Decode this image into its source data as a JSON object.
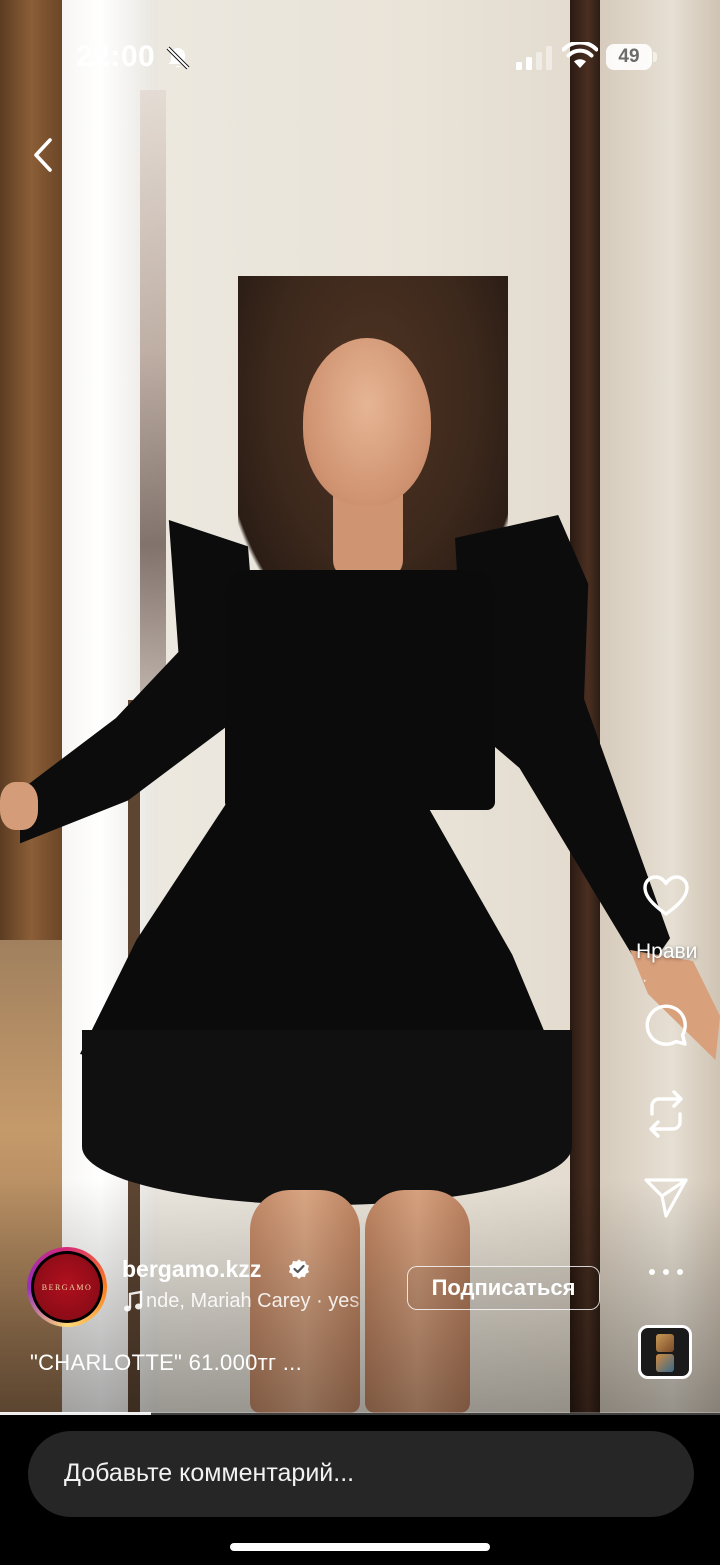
{
  "status_bar": {
    "time": "22:00",
    "battery": "49",
    "icons": [
      "bell-slash-icon",
      "signal-icon",
      "wifi-icon",
      "battery-icon"
    ]
  },
  "navigation": {
    "back_icon": "chevron-left-icon"
  },
  "actions": {
    "like_label": "Нрави",
    "like_count": "·",
    "icons": [
      "heart-icon",
      "comment-icon",
      "repost-icon",
      "send-icon",
      "more-icon"
    ]
  },
  "account": {
    "avatar_text": "BERGAMO",
    "username": "bergamo.kzz",
    "verified": true,
    "audio": "nde, Mariah Carey · yes",
    "follow_label": "Подписаться"
  },
  "caption": "\"CHARLOTTE\" 61.000тг ...",
  "playback": {
    "progress": 0.21
  },
  "comment": {
    "placeholder": "Добавьте комментарий..."
  },
  "colors": {
    "background": "#000000",
    "comment_field": "#262626",
    "avatar_brand": "#9b0d18",
    "text": "#ffffff"
  }
}
